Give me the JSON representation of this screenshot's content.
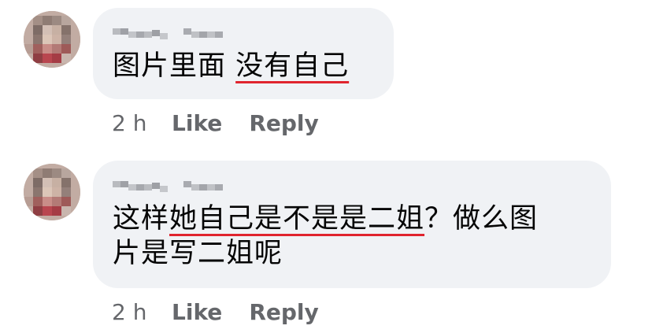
{
  "comments": [
    {
      "author": "Yongqi Lee",
      "text_plain": "图片里面 ",
      "text_mark": "没有自己",
      "text_rest_line1": "",
      "text_line2": "",
      "time": "2 h",
      "like_label": "Like",
      "reply_label": "Reply"
    },
    {
      "author": "Yongqi Lee",
      "text_plain": "这样",
      "text_mark": "她自己是不是是二姐",
      "text_rest_line1": "？做么图",
      "text_line2": "片是写二姐呢",
      "time": "2 h",
      "like_label": "Like",
      "reply_label": "Reply"
    }
  ],
  "colors": {
    "bubble": "#f0f2f5",
    "meta_text": "#65676b",
    "underline": "#e0242e"
  }
}
